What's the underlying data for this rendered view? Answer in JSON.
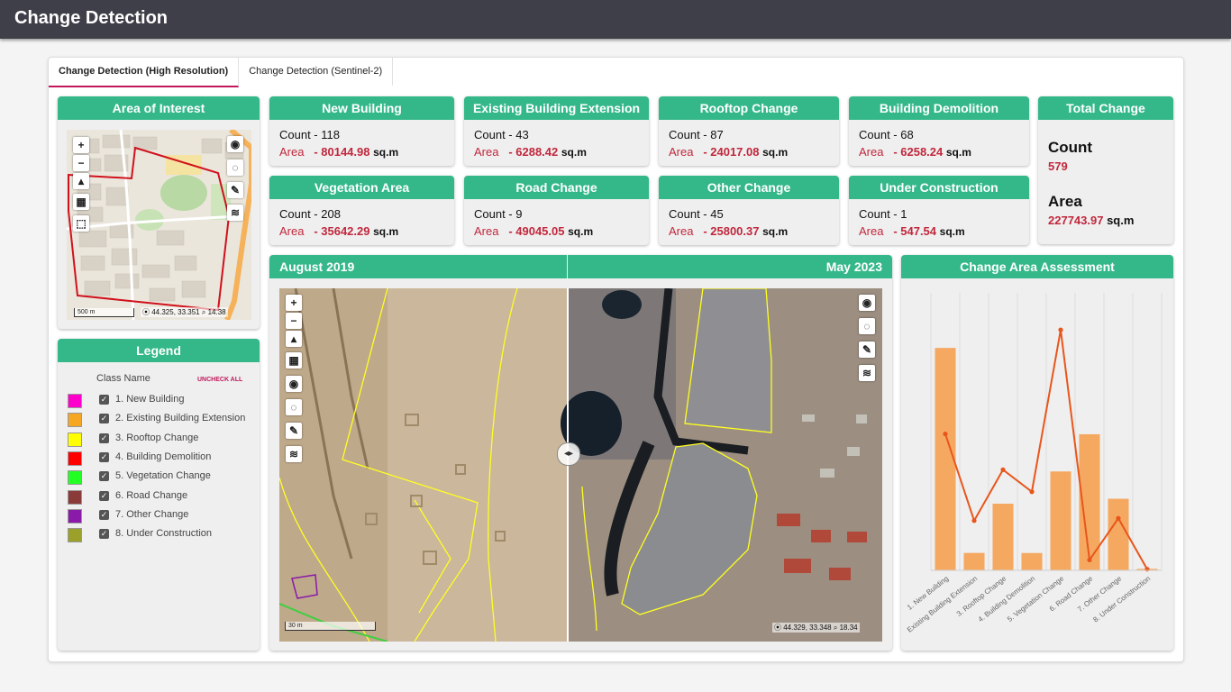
{
  "app": {
    "title": "Change Detection"
  },
  "tabs": [
    {
      "label": "Change Detection (High Resolution)",
      "active": true
    },
    {
      "label": "Change Detection (Sentinel-2)",
      "active": false
    }
  ],
  "aoi": {
    "title": "Area of Interest",
    "scale": "500 m",
    "coords": "44.325, 33.351",
    "zoom": "14.38"
  },
  "cards": [
    {
      "title": "New Building",
      "count": "Count - 118",
      "area_label": "Area",
      "area_value": "- 80144.98",
      "unit": "sq.m"
    },
    {
      "title": "Existing Building Extension",
      "count": "Count - 43",
      "area_label": "Area",
      "area_value": "- 6288.42",
      "unit": "sq.m"
    },
    {
      "title": "Rooftop Change",
      "count": "Count - 87",
      "area_label": "Area",
      "area_value": "- 24017.08",
      "unit": "sq.m"
    },
    {
      "title": "Building Demolition",
      "count": "Count - 68",
      "area_label": "Area",
      "area_value": "- 6258.24",
      "unit": "sq.m"
    },
    {
      "title": "Vegetation Area",
      "count": "Count - 208",
      "area_label": "Area",
      "area_value": "- 35642.29",
      "unit": "sq.m"
    },
    {
      "title": "Road Change",
      "count": "Count - 9",
      "area_label": "Area",
      "area_value": "- 49045.05",
      "unit": "sq.m"
    },
    {
      "title": "Other Change",
      "count": "Count - 45",
      "area_label": "Area",
      "area_value": "- 25800.37",
      "unit": "sq.m"
    },
    {
      "title": "Under Construction",
      "count": "Count - 1",
      "area_label": "Area",
      "area_value": "- 547.54",
      "unit": "sq.m"
    }
  ],
  "total": {
    "title": "Total Change",
    "count_label": "Count",
    "count_value": "579",
    "area_label": "Area",
    "area_value": "227743.97",
    "area_unit": "sq.m"
  },
  "legend": {
    "title": "Legend",
    "header": "Class Name",
    "uncheck_all": "UNCHECK ALL",
    "items": [
      {
        "label": "1. New Building",
        "color": "#ff00cc",
        "checked": true
      },
      {
        "label": "2. Existing Building Extension",
        "color": "#f5a623",
        "checked": true
      },
      {
        "label": "3. Rooftop Change",
        "color": "#ffff00",
        "checked": true
      },
      {
        "label": "4. Building Demolition",
        "color": "#ff0000",
        "checked": true
      },
      {
        "label": "5. Vegetation Change",
        "color": "#22ff22",
        "checked": true
      },
      {
        "label": "6. Road Change",
        "color": "#8b3a3a",
        "checked": true
      },
      {
        "label": "7. Other Change",
        "color": "#8a1aa8",
        "checked": true
      },
      {
        "label": "8. Under Construction",
        "color": "#9aa02a",
        "checked": true
      }
    ]
  },
  "compare": {
    "left_date": "August 2019",
    "right_date": "May 2023",
    "scale": "30 m",
    "coords": "44.329, 33.348",
    "zoom": "18.34"
  },
  "chart_panel": {
    "title": "Change Area Assessment"
  },
  "chart_data": {
    "type": "bar",
    "categories": [
      "1. New Building",
      "Existing Building Extension",
      "3. Rooftop Change",
      "4. Building Demolition",
      "5. Vegetation Change",
      "6. Road Change",
      "7. Other Change",
      "8. Under Construction"
    ],
    "series": [
      {
        "type": "bar",
        "values": [
          80144.98,
          6288.42,
          24017.08,
          6258.24,
          35642.29,
          49045.05,
          25800.37,
          547.54
        ],
        "color": "#f5a860"
      },
      {
        "type": "line",
        "values": [
          118,
          43,
          87,
          68,
          208,
          9,
          45,
          1
        ],
        "color": "#e8561c"
      }
    ],
    "ylim_bar": [
      0,
      100000
    ],
    "ylim_line": [
      0,
      240
    ],
    "grid": "vertical"
  }
}
